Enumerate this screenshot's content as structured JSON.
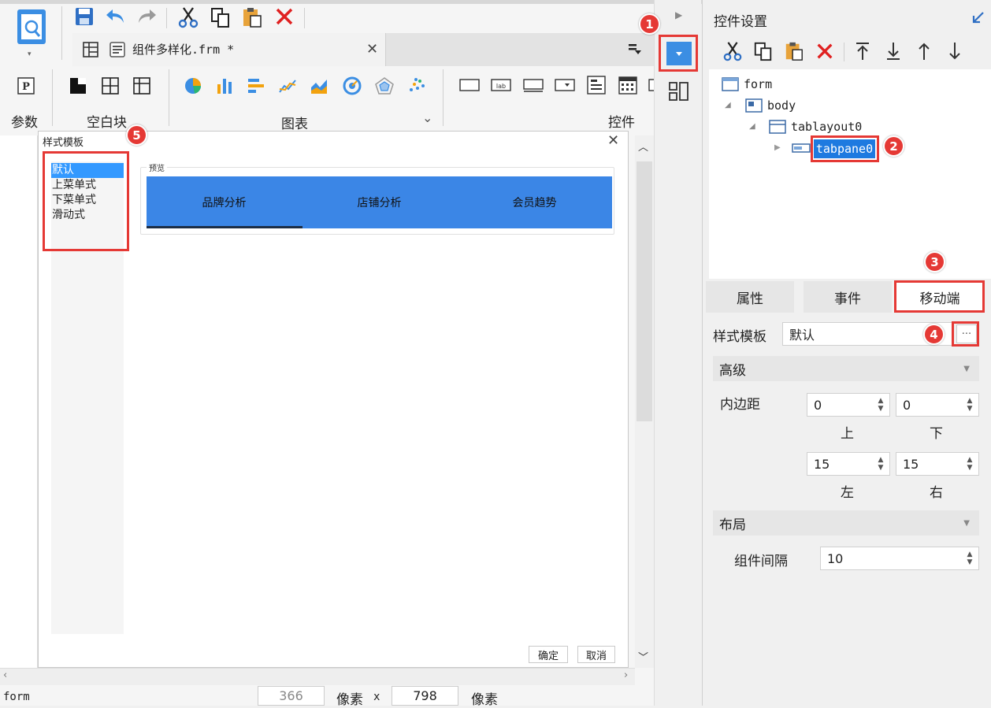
{
  "doc_tab": {
    "title": "组件多样化.frm *"
  },
  "ribbon": {
    "groups": [
      "参数",
      "空白块",
      "图表",
      "控件"
    ],
    "chart_expand": "⌄"
  },
  "dialog": {
    "title": "样式模板",
    "styles": [
      "默认",
      "上菜单式",
      "下菜单式",
      "滑动式"
    ],
    "preview_label": "预览",
    "preview_tabs": [
      "品牌分析",
      "店铺分析",
      "会员趋势"
    ],
    "ok": "确定",
    "cancel": "取消"
  },
  "statusbar": {
    "object": "form",
    "width": "366",
    "unit1": "像素",
    "x": "x",
    "height": "798",
    "unit2": "像素"
  },
  "right": {
    "title": "控件设置",
    "tree": [
      "form",
      "body",
      "tablayout0",
      "tabpane0"
    ],
    "tabs": [
      "属性",
      "事件",
      "移动端"
    ],
    "style_label": "样式模板",
    "style_value": "默认",
    "more": "···",
    "advanced": "高级",
    "padding_label": "内边距",
    "padding_top": "0",
    "padding_bottom": "0",
    "padding_left": "15",
    "padding_right": "15",
    "cap_top": "上",
    "cap_bottom": "下",
    "cap_left": "左",
    "cap_right": "右",
    "layout": "布局",
    "gap_label": "组件间隔",
    "gap_value": "10"
  },
  "callouts": [
    "1",
    "2",
    "3",
    "4",
    "5"
  ],
  "colors": {
    "accent": "#3b86e6",
    "callout": "#e53935",
    "selection": "#1e7ae0"
  }
}
